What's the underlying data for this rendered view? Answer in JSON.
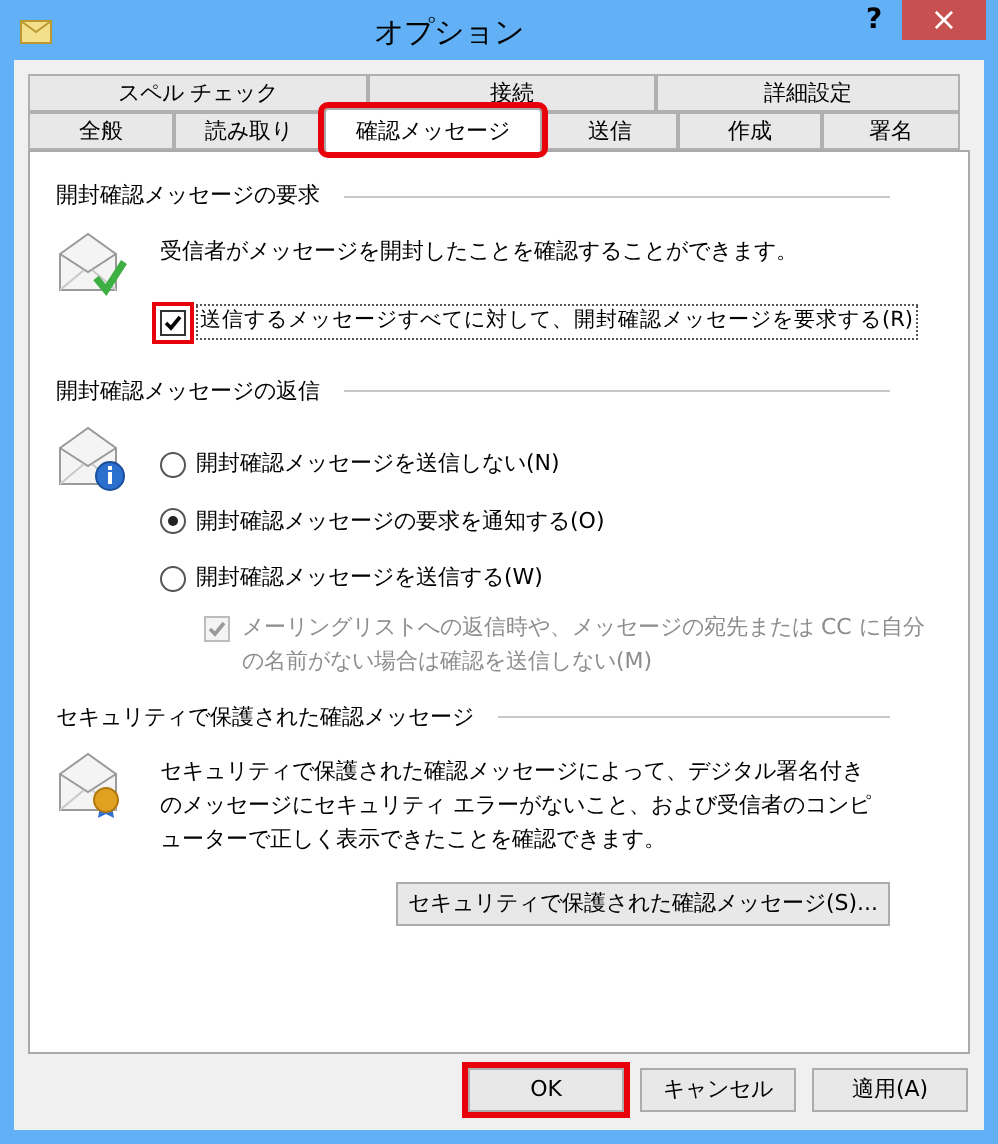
{
  "window": {
    "title": "オプション",
    "help": "?",
    "close": "×"
  },
  "tab_rows": [
    [
      {
        "label": "スペル チェック",
        "selected": false,
        "highlighted": false
      },
      {
        "label": "接続",
        "selected": false,
        "highlighted": false
      },
      {
        "label": "詳細設定",
        "selected": false,
        "highlighted": false
      }
    ],
    [
      {
        "label": "全般",
        "selected": false,
        "highlighted": false
      },
      {
        "label": "読み取り",
        "selected": false,
        "highlighted": false
      },
      {
        "label": "確認メッセージ",
        "selected": true,
        "highlighted": true
      },
      {
        "label": "送信",
        "selected": false,
        "highlighted": false
      },
      {
        "label": "作成",
        "selected": false,
        "highlighted": false
      },
      {
        "label": "署名",
        "selected": false,
        "highlighted": false
      }
    ]
  ],
  "sections": [
    {
      "title": "開封確認メッセージの要求",
      "description": "受信者がメッセージを開封したことを確認することができます。",
      "checkbox": {
        "label": "送信するメッセージすべてに対して、開封確認メッセージを要求する(R)",
        "checked": true,
        "highlighted": true
      }
    },
    {
      "title": "開封確認メッセージの返信",
      "options": [
        {
          "label": "開封確認メッセージを送信しない(N)",
          "selected": false
        },
        {
          "label": "開封確認メッセージの要求を通知する(O)",
          "selected": true
        },
        {
          "label": "開封確認メッセージを送信する(W)",
          "selected": false
        }
      ],
      "sub_checkbox": {
        "label": "メーリングリストへの返信時や、メッセージの宛先または CC に自分の名前がない場合は確認を送信しない(M)",
        "checked": true,
        "disabled": true
      }
    },
    {
      "title": "セキュリティで保護された確認メッセージ",
      "description": "セキュリティで保護された確認メッセージによって、デジタル署名付きのメッセージにセキュリティ エラーがないこと、および受信者のコンピューターで正しく表示できたことを確認できます。",
      "button": "セキュリティで保護された確認メッセージ(S)..."
    }
  ],
  "buttons": [
    {
      "label": "OK",
      "highlighted": true
    },
    {
      "label": "キャンセル",
      "highlighted": false
    },
    {
      "label": "適用(A)",
      "highlighted": false
    }
  ]
}
